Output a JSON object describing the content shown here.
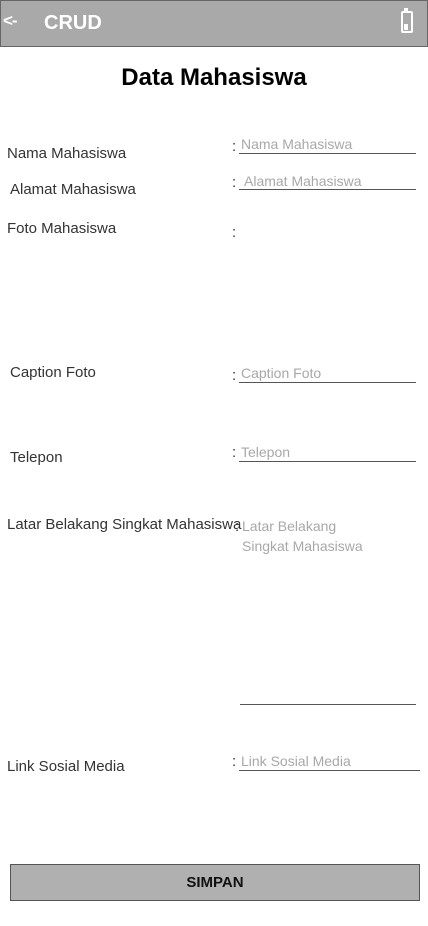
{
  "appbar": {
    "back_label": "<-",
    "title": "CRUD",
    "right_icon": "battery-icon",
    "background": "#a9a9a9"
  },
  "page": {
    "title": "Data Mahasiswa"
  },
  "form": {
    "colon": ":",
    "nama": {
      "label": "Nama Mahasiswa",
      "placeholder": "Nama Mahasiswa",
      "value": ""
    },
    "alamat": {
      "label": "Alamat Mahasiswa",
      "placeholder": "Alamat Mahasiswa",
      "value": ""
    },
    "foto": {
      "label": "Foto Mahasiswa"
    },
    "caption": {
      "label": "Caption Foto",
      "placeholder": "Caption Foto",
      "value": ""
    },
    "telepon": {
      "label": "Telepon",
      "placeholder": "Telepon",
      "value": ""
    },
    "latar": {
      "label": "Latar Belakang Singkat Mahasiswa",
      "placeholder": "Latar Belakang\nSingkat Mahasiswa",
      "value": ""
    },
    "link": {
      "label": "Link Sosial Media",
      "placeholder": "Link Sosial Media",
      "value": ""
    }
  },
  "actions": {
    "save_label": "SIMPAN"
  }
}
